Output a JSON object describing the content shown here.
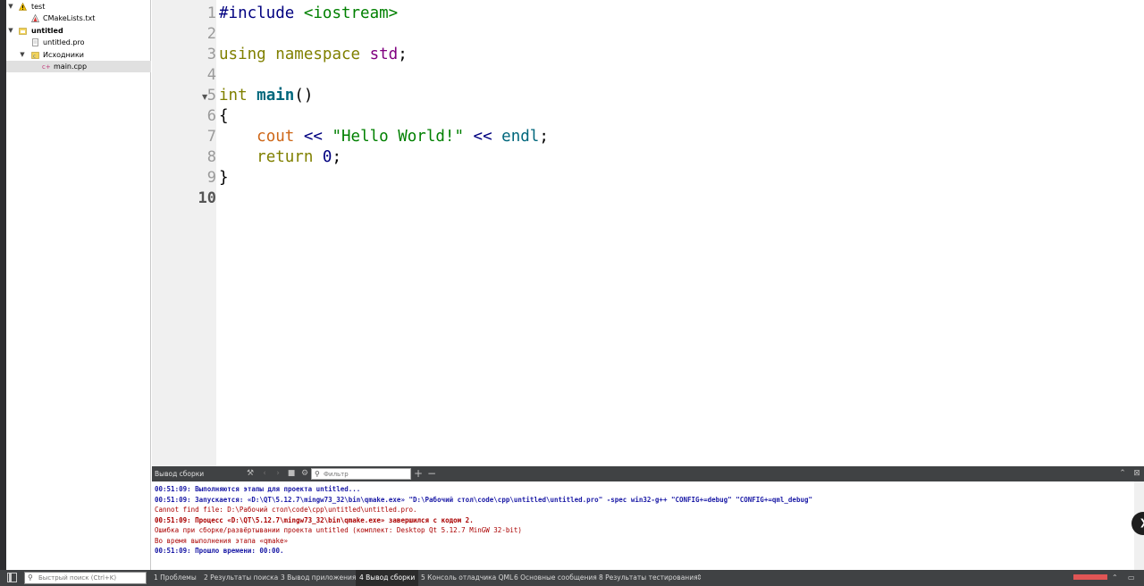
{
  "project_tree": {
    "items": [
      {
        "label": "test",
        "expanded": true,
        "icon": "warning-icon"
      },
      {
        "label": "CMakeLists.txt",
        "icon": "cmake-file-icon"
      },
      {
        "label": "untitled",
        "expanded": true,
        "icon": "project-folder-icon"
      },
      {
        "label": "untitled.pro",
        "icon": "pro-file-icon"
      },
      {
        "label": "Исходники",
        "expanded": true,
        "icon": "sources-folder-icon"
      },
      {
        "label": "main.cpp",
        "icon": "cpp-file-icon",
        "selected": true
      }
    ]
  },
  "editor": {
    "line_numbers": [
      "1",
      "2",
      "3",
      "4",
      "5",
      "6",
      "7",
      "8",
      "9",
      "10"
    ],
    "current_line": "10",
    "code": {
      "l1_pre": "#include",
      "l1_inc": "<iostream>",
      "l3_using": "using",
      "l3_namespace": "namespace",
      "l3_std": "std",
      "l3_semi": ";",
      "l5_int": "int",
      "l5_main": "main",
      "l5_parens": "()",
      "l6_brace": "{",
      "l7_cout": "cout",
      "l7_op1": "<<",
      "l7_str": "\"Hello World!\"",
      "l7_op2": "<<",
      "l7_endl": "endl",
      "l7_semi": ";",
      "l8_return": "return",
      "l8_zero": "0",
      "l8_semi": ";",
      "l9_brace": "}"
    }
  },
  "output_panel": {
    "title": "Вывод сборки",
    "filter_placeholder": "Фильтр",
    "lines": [
      {
        "text": "00:51:09: Выполняются этапы для проекта untitled...",
        "style": "info"
      },
      {
        "text": "00:51:09: Запускается: «D:\\QT\\5.12.7\\mingw73_32\\bin\\qmake.exe» \"D:\\Рабочий стол\\code\\cpp\\untitled\\untitled.pro\" -spec win32-g++ \"CONFIG+=debug\" \"CONFIG+=qml_debug\"",
        "style": "info"
      },
      {
        "text": "Cannot find file: D:\\Рабочий стол\\code\\cpp\\untitled\\untitled.pro.",
        "style": "error"
      },
      {
        "text": "00:51:09: Процесс «D:\\QT\\5.12.7\\mingw73_32\\bin\\qmake.exe» завершился с кодом 2.",
        "style": "error-bold"
      },
      {
        "text": "Ошибка при сборке/развёртывании проекта untitled (комплект: Desktop Qt 5.12.7 MinGW 32-bit)",
        "style": "error"
      },
      {
        "text": "Во время выполнения этапа «qmake»",
        "style": "error"
      },
      {
        "text": "00:51:09: Прошло времени: 00:00.",
        "style": "info"
      }
    ]
  },
  "status_bar": {
    "quick_search_placeholder": "Быстрый поиск (Ctrl+K)",
    "tabs": [
      {
        "label": "1  Проблемы"
      },
      {
        "label": "2  Результаты поиска"
      },
      {
        "label": "3  Вывод приложения"
      },
      {
        "label": "4  Вывод сборки",
        "active": true
      },
      {
        "label": "5  Консоль отладчика QML"
      },
      {
        "label": "6  Основные сообщения"
      },
      {
        "label": "8  Результаты тестирования"
      }
    ],
    "build_progress": 1.0
  },
  "colors": {
    "keyword": "#808000",
    "string": "#008000",
    "error": "#aa0000",
    "info": "#1a1aa6",
    "panel_bg": "#404244",
    "progress": "#e05555"
  }
}
